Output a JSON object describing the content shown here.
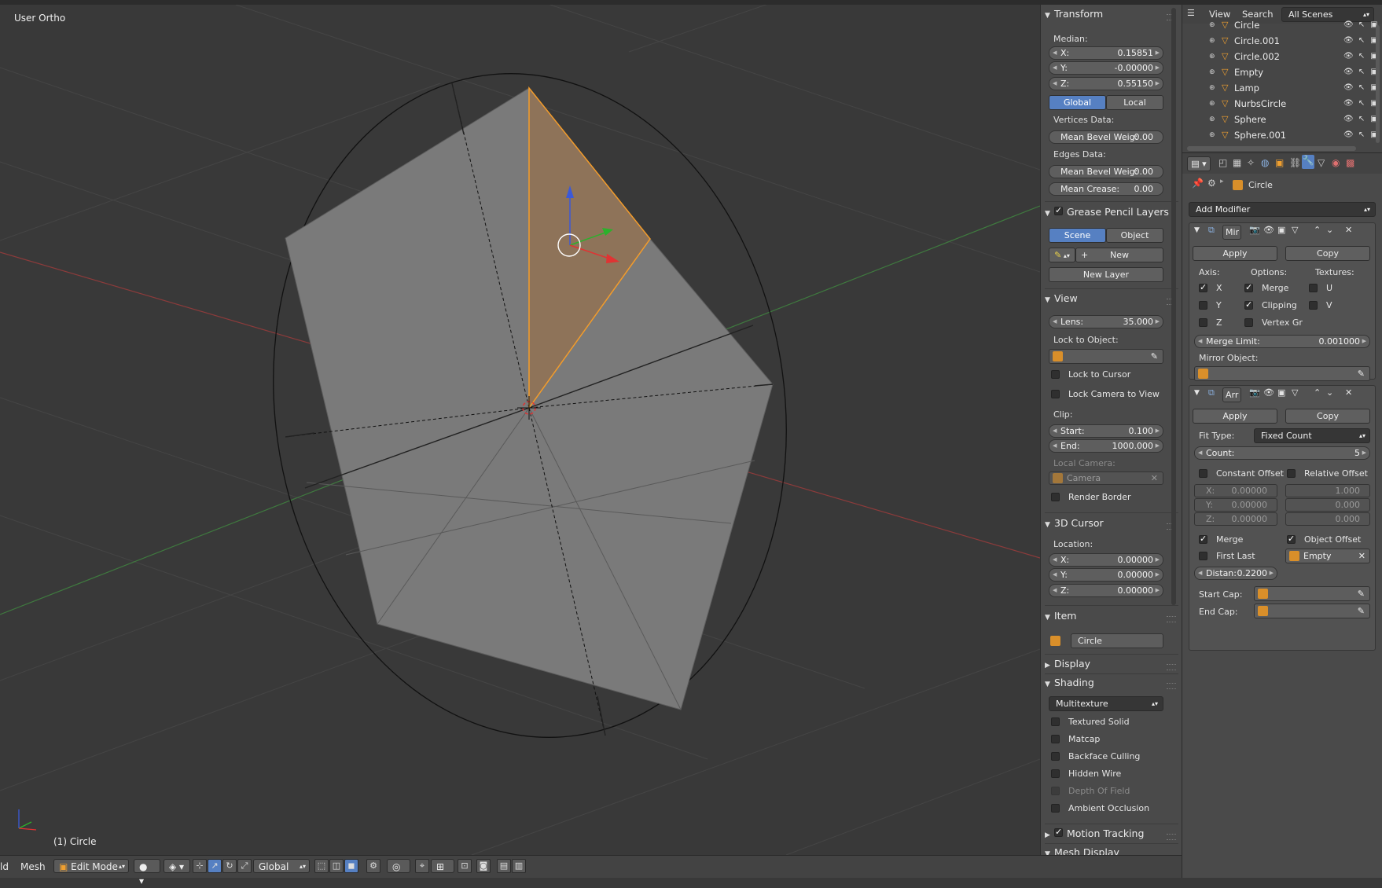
{
  "viewport": {
    "view_label": "User Ortho",
    "object_label": "(1) Circle"
  },
  "bottom_header": {
    "view_menu": "ld",
    "mesh_menu": "Mesh",
    "mode": "Edit Mode",
    "orientation": "Global"
  },
  "npanel": {
    "transform": {
      "title": "Transform",
      "median_label": "Median:",
      "x_label": "X:",
      "x": "0.15851",
      "y_label": "Y:",
      "y": "-0.00000",
      "z_label": "Z:",
      "z": "0.55150",
      "global": "Global",
      "local": "Local",
      "vertices_data": "Vertices Data:",
      "v_bevel_label": "Mean Bevel Weig:",
      "v_bevel": "0.00",
      "edges_data": "Edges Data:",
      "e_bevel_label": "Mean Bevel Weig:",
      "e_bevel": "0.00",
      "crease_label": "Mean Crease:",
      "crease": "0.00"
    },
    "grease": {
      "title": "Grease Pencil Layers",
      "scene": "Scene",
      "object": "Object",
      "new": "New",
      "new_layer": "New Layer"
    },
    "view": {
      "title": "View",
      "lens_label": "Lens:",
      "lens": "35.000",
      "lock_object": "Lock to Object:",
      "lock_cursor": "Lock to Cursor",
      "lock_camera": "Lock Camera to View",
      "clip": "Clip:",
      "start_label": "Start:",
      "start": "0.100",
      "end_label": "End:",
      "end": "1000.000",
      "local_camera": "Local Camera:",
      "camera": "Camera",
      "render_border": "Render Border"
    },
    "cursor": {
      "title": "3D Cursor",
      "location": "Location:",
      "x_label": "X:",
      "x": "0.00000",
      "y_label": "Y:",
      "y": "0.00000",
      "z_label": "Z:",
      "z": "0.00000"
    },
    "item": {
      "title": "Item",
      "name": "Circle"
    },
    "display": {
      "title": "Display"
    },
    "shading": {
      "title": "Shading",
      "mode": "Multitexture",
      "textured_solid": "Textured Solid",
      "matcap": "Matcap",
      "backface": "Backface Culling",
      "hidden_wire": "Hidden Wire",
      "dof": "Depth Of Field",
      "ao": "Ambient Occlusion"
    },
    "motion_tracking": {
      "title": "Motion Tracking"
    },
    "mesh_display": {
      "title": "Mesh Display"
    }
  },
  "outliner": {
    "view": "View",
    "search": "Search",
    "scenes": "All Scenes",
    "items": [
      {
        "name": "Circle"
      },
      {
        "name": "Circle.001"
      },
      {
        "name": "Circle.002"
      },
      {
        "name": "Empty"
      },
      {
        "name": "Lamp"
      },
      {
        "name": "NurbsCircle"
      },
      {
        "name": "Sphere"
      },
      {
        "name": "Sphere.001"
      }
    ]
  },
  "properties": {
    "object_name": "Circle",
    "add_modifier": "Add Modifier",
    "mirror": {
      "name": "Mir",
      "apply": "Apply",
      "copy": "Copy",
      "axis": "Axis:",
      "options": "Options:",
      "textures": "Textures:",
      "x": "X",
      "y": "Y",
      "z": "Z",
      "merge": "Merge",
      "clipping": "Clipping",
      "vertex_gr": "Vertex Gr",
      "u": "U",
      "v": "V",
      "merge_limit_label": "Merge Limit:",
      "merge_limit": "0.001000",
      "mirror_object": "Mirror Object:"
    },
    "array": {
      "name": "Arr",
      "apply": "Apply",
      "copy": "Copy",
      "fit_type_label": "Fit Type:",
      "fit_type": "Fixed Count",
      "count_label": "Count:",
      "count": "5",
      "constant_offset": "Constant Offset",
      "relative_offset": "Relative Offset",
      "cx_label": "X:",
      "cx": "0.00000",
      "cy_label": "Y:",
      "cy": "0.00000",
      "cz_label": "Z:",
      "cz": "0.00000",
      "rx": "1.000",
      "ry": "0.000",
      "rz": "0.000",
      "merge": "Merge",
      "object_offset": "Object Offset",
      "first_last": "First Last",
      "offset_object": "Empty",
      "distance_label": "Distan:",
      "distance": "0.2200",
      "start_cap": "Start Cap:",
      "end_cap": "End Cap:"
    }
  },
  "colors": {
    "viewport_bg": "#393939",
    "selection": "#f39c2b",
    "panel_bg": "#4a4a4a",
    "accent_blue": "#5680c2"
  }
}
